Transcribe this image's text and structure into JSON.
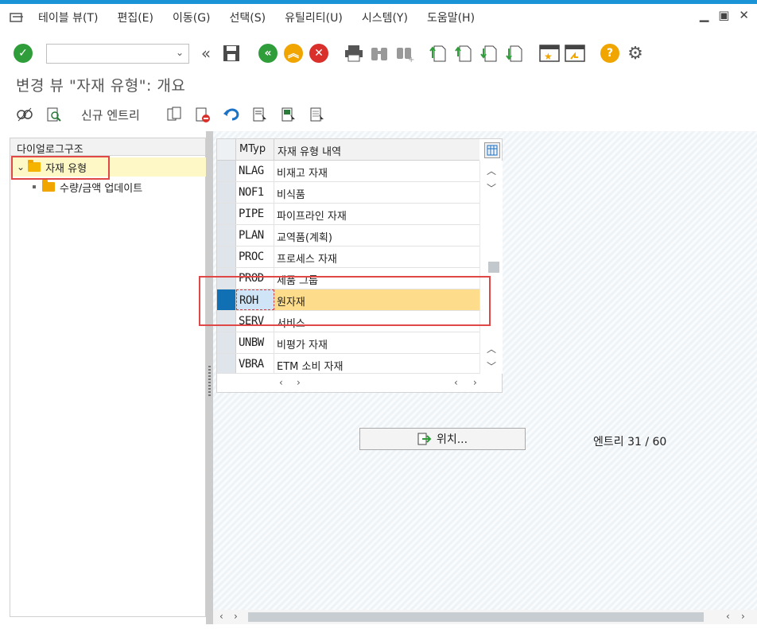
{
  "menubar": {
    "items": [
      "테이블 뷰(T)",
      "편집(E)",
      "이동(G)",
      "선택(S)",
      "유틸리티(U)",
      "시스템(Y)",
      "도움말(H)"
    ]
  },
  "window_controls": [
    "minimize-icon",
    "maximize-icon",
    "close-icon"
  ],
  "toolbar": {
    "command_field_value": "",
    "icons": [
      "enter-check-icon",
      "double-left-icon",
      "save-icon",
      "back-icon",
      "exit-icon",
      "cancel-icon",
      "print-icon",
      "find-icon",
      "find-next-icon",
      "first-page-icon",
      "previous-page-icon",
      "next-page-icon",
      "last-page-icon",
      "new-session-icon",
      "shortcut-icon",
      "help-icon",
      "settings-icon"
    ]
  },
  "page_title": "변경 뷰 \"자재 유형\": 개요",
  "app_toolbar": {
    "new_entries_label": "신규 엔트리"
  },
  "left_panel": {
    "header": "다이얼로그구조",
    "tree": [
      {
        "label": "자재 유형",
        "expanded": true,
        "selected": true
      },
      {
        "label": "수량/금액 업데이트"
      }
    ]
  },
  "grid": {
    "columns": [
      "MTyp",
      "자재 유형 내역"
    ],
    "rows": [
      {
        "code": "NLAG",
        "desc": "비재고 자재"
      },
      {
        "code": "NOF1",
        "desc": "비식품"
      },
      {
        "code": "PIPE",
        "desc": "파이프라인 자재"
      },
      {
        "code": "PLAN",
        "desc": "교역품(계획)"
      },
      {
        "code": "PROC",
        "desc": "프로세스 자재"
      },
      {
        "code": "PROD",
        "desc": "제품 그룹"
      },
      {
        "code": "ROH",
        "desc": "원자재",
        "selected": true
      },
      {
        "code": "SERV",
        "desc": "서비스"
      },
      {
        "code": "UNBW",
        "desc": "비평가 자재"
      },
      {
        "code": "VBRA",
        "desc": "ETM 소비 자재"
      }
    ]
  },
  "position_button": "위치...",
  "entry_counter": "엔트리 31 / 60",
  "colors": {
    "accent": "#1a93d7",
    "selected_row": "#fddc8c",
    "highlight": "#e04848"
  }
}
